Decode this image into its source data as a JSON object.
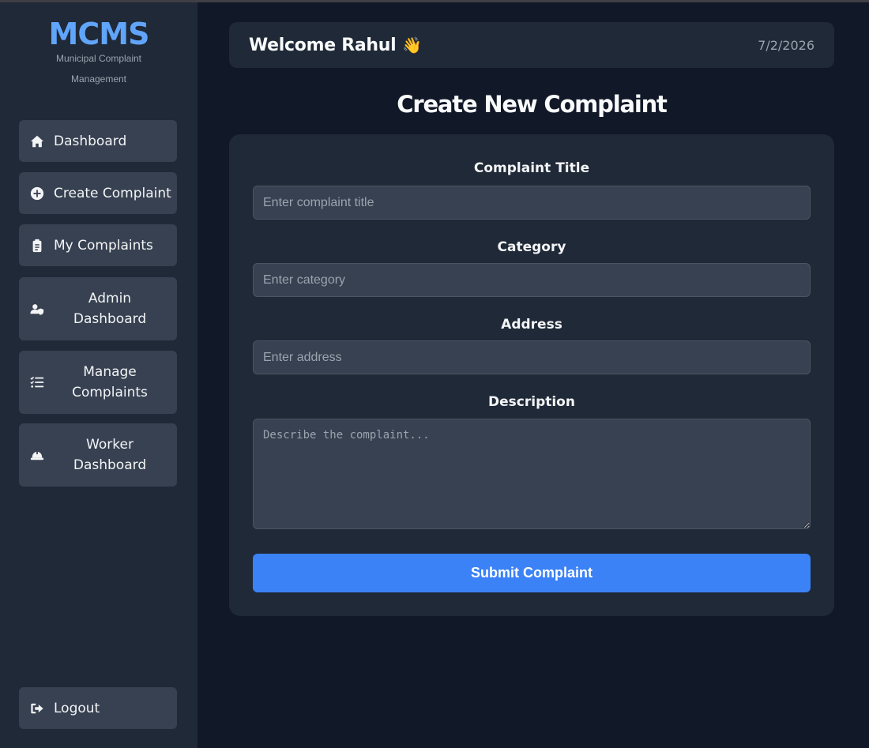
{
  "brand": {
    "title": "MCMS",
    "subtitle": "Municipal Complaint Management"
  },
  "sidebar": {
    "items": [
      {
        "label": "Dashboard",
        "icon": "home-icon"
      },
      {
        "label": "Create Complaint",
        "icon": "plus-circle-icon"
      },
      {
        "label": "My Complaints",
        "icon": "clipboard-list-icon"
      },
      {
        "label": "Admin Dashboard",
        "icon": "user-shield-icon"
      },
      {
        "label": "Manage Complaints",
        "icon": "list-check-icon"
      },
      {
        "label": "Worker Dashboard",
        "icon": "hard-hat-icon"
      }
    ],
    "logout": {
      "label": "Logout",
      "icon": "sign-out-icon"
    }
  },
  "header": {
    "welcome": "Welcome Rahul",
    "emoji": "👋",
    "date": "7/2/2026"
  },
  "page": {
    "title": "Create New Complaint"
  },
  "form": {
    "title_label": "Complaint Title",
    "title_placeholder": "Enter complaint title",
    "title_value": "",
    "category_label": "Category",
    "category_placeholder": "Enter category",
    "category_value": "",
    "address_label": "Address",
    "address_placeholder": "Enter address",
    "address_value": "",
    "description_label": "Description",
    "description_placeholder": "Describe the complaint...",
    "description_value": "",
    "submit_label": "Submit Complaint"
  },
  "colors": {
    "accent": "#3b82f6",
    "brand": "#60a5fa",
    "sidebar_bg": "#1f2937",
    "main_bg": "#111827",
    "button_bg": "#374151"
  }
}
